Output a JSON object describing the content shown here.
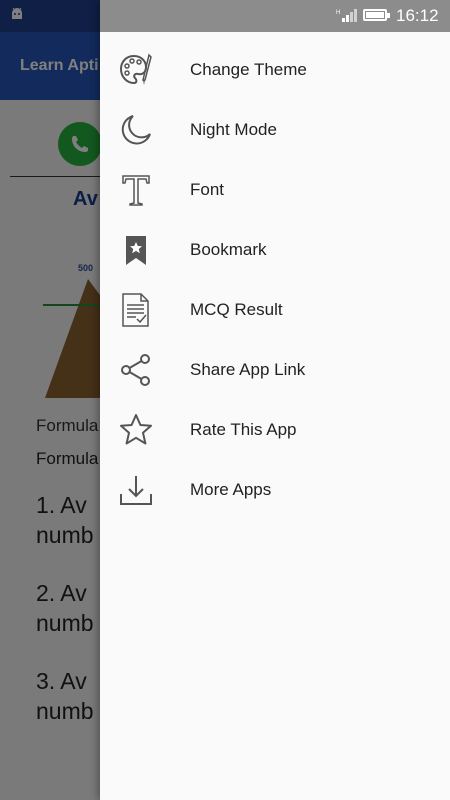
{
  "status_bar": {
    "time": "16:12"
  },
  "background": {
    "app_title": "Learn Apti",
    "heading": "Av",
    "chart_value": "500",
    "formula_line1": "Formula",
    "formula_line2": "Formula",
    "items": [
      {
        "line1": "1. Av",
        "line2": "numb"
      },
      {
        "line1": "2. Av",
        "line2": "numb"
      },
      {
        "line1": "3. Av",
        "line2": "numb"
      }
    ]
  },
  "drawer": {
    "items": [
      {
        "label": "Change Theme",
        "icon": "palette-icon"
      },
      {
        "label": "Night Mode",
        "icon": "moon-icon"
      },
      {
        "label": "Font",
        "icon": "font-icon"
      },
      {
        "label": "Bookmark",
        "icon": "bookmark-icon"
      },
      {
        "label": "MCQ Result",
        "icon": "document-icon"
      },
      {
        "label": "Share App Link",
        "icon": "share-icon"
      },
      {
        "label": "Rate This App",
        "icon": "star-icon"
      },
      {
        "label": "More Apps",
        "icon": "download-icon"
      }
    ]
  },
  "colors": {
    "header": "#2454b8",
    "whatsapp": "#25b03e",
    "drawer_bg": "#fafafa",
    "icon": "#555555"
  }
}
